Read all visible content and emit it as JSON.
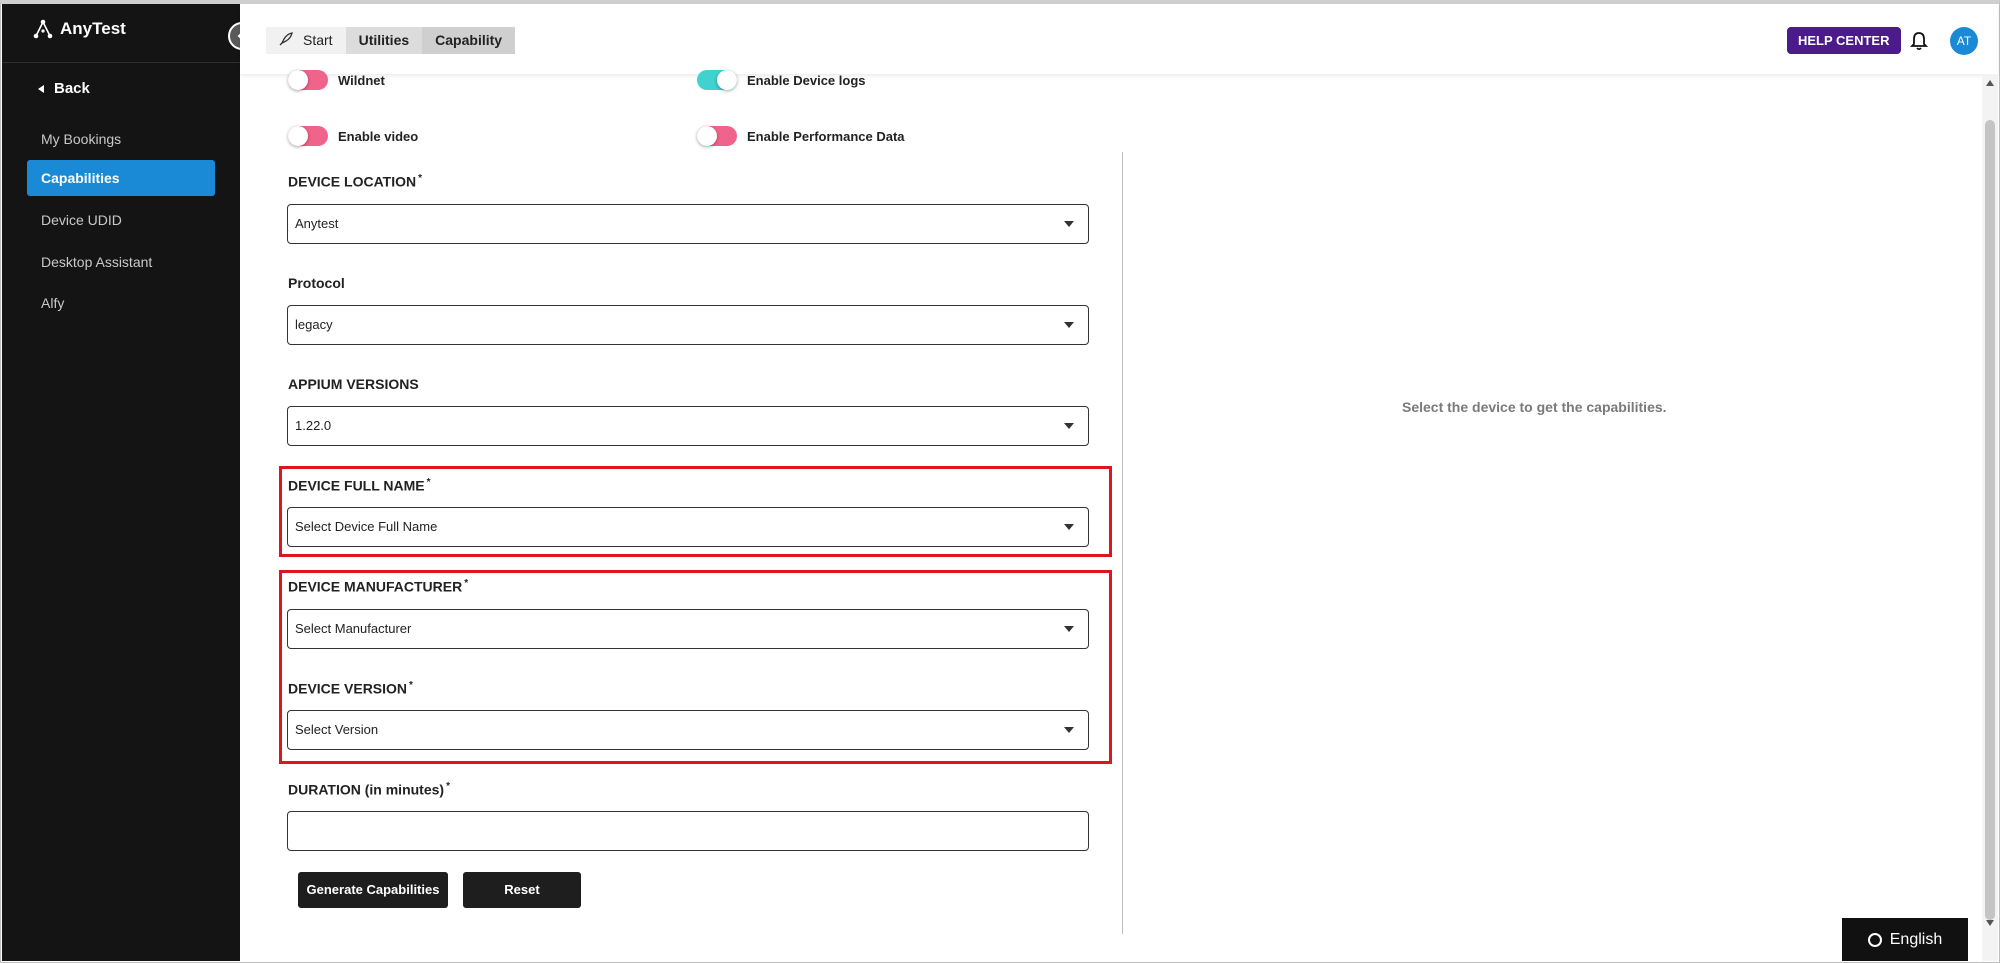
{
  "app": {
    "name": "AnyTest"
  },
  "sidebar": {
    "back_label": "Back",
    "items": [
      {
        "label": "My Bookings",
        "active": false
      },
      {
        "label": "Capabilities",
        "active": true
      },
      {
        "label": "Device UDID",
        "active": false
      },
      {
        "label": "Desktop Assistant",
        "active": false
      },
      {
        "label": "Alfy",
        "active": false
      }
    ]
  },
  "header": {
    "tabs": [
      {
        "label": "Start",
        "icon": "rocket-icon"
      },
      {
        "label": "Utilities"
      },
      {
        "label": "Capability",
        "selected": true
      }
    ],
    "help_label": "HELP CENTER",
    "avatar_initials": "AT",
    "colors": {
      "help": "#4b1b8c",
      "avatar": "#1a8ad6"
    }
  },
  "toggles": [
    {
      "label": "Wildnet",
      "on": false
    },
    {
      "label": "Enable Device logs",
      "on": true
    },
    {
      "label": "Enable video",
      "on": false
    },
    {
      "label": "Enable Performance Data",
      "on": false
    }
  ],
  "fields": {
    "location": {
      "label": "DEVICE LOCATION",
      "required": "*",
      "value": "Anytest"
    },
    "protocol": {
      "label": "Protocol",
      "value": "legacy"
    },
    "appium": {
      "label": "APPIUM VERSIONS",
      "value": "1.22.0"
    },
    "full_name": {
      "label": "DEVICE FULL NAME",
      "required": "*",
      "placeholder": "Select Device Full Name"
    },
    "manufacturer": {
      "label": "DEVICE MANUFACTURER",
      "required": "*",
      "placeholder": "Select Manufacturer"
    },
    "version": {
      "label": "DEVICE VERSION",
      "required": "*",
      "placeholder": "Select Version"
    },
    "duration": {
      "label": "DURATION (in minutes)",
      "required": "*",
      "value": ""
    }
  },
  "actions": {
    "generate_label": "Generate Capabilities",
    "reset_label": "Reset"
  },
  "right_panel": {
    "message": "Select the device to get the capabilities."
  },
  "language": {
    "label": "English"
  },
  "highlight_color": "#e0141c",
  "accent_color": "#1a8ad6"
}
